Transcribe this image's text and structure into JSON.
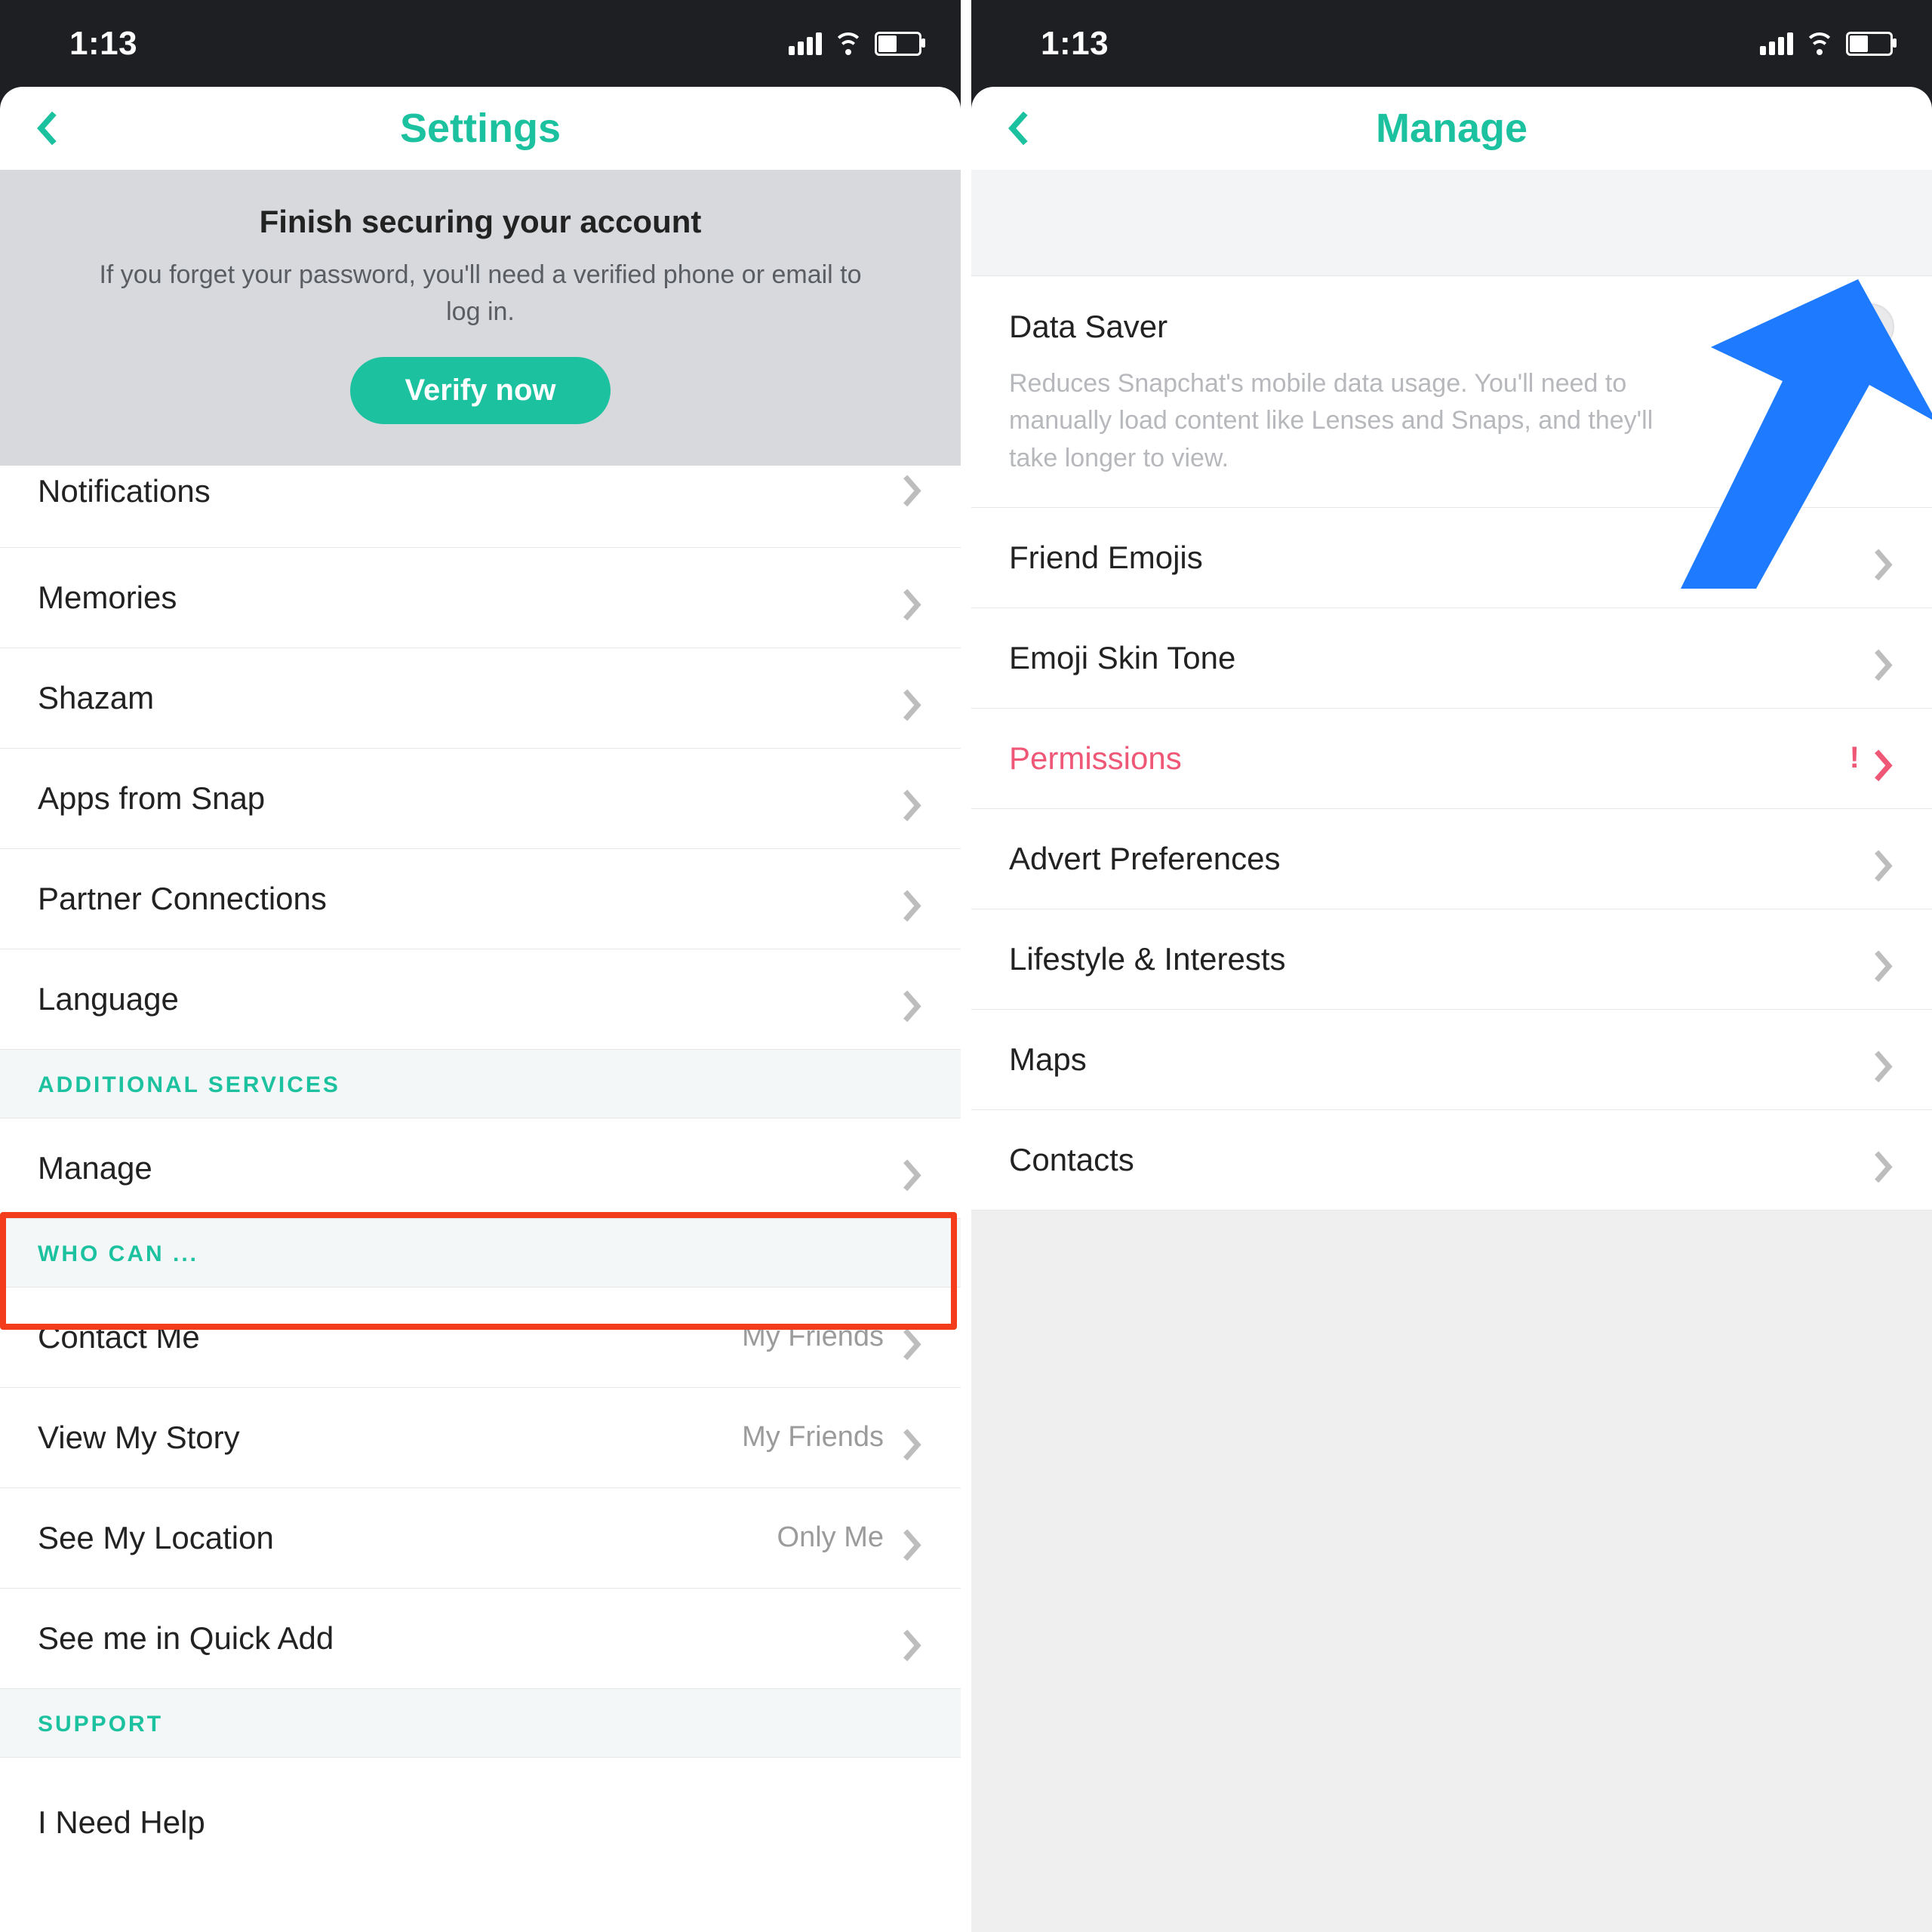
{
  "status": {
    "time": "1:13"
  },
  "left": {
    "title": "Settings",
    "banner": {
      "title": "Finish securing your account",
      "desc": "If you forget your password, you'll need a verified phone or email to log in.",
      "cta": "Verify now"
    },
    "rows_top": [
      {
        "label": "Notifications"
      },
      {
        "label": "Memories"
      },
      {
        "label": "Shazam"
      },
      {
        "label": "Apps from Snap"
      },
      {
        "label": "Partner Connections"
      },
      {
        "label": "Language"
      }
    ],
    "section_additional": "ADDITIONAL SERVICES",
    "rows_additional": [
      {
        "label": "Manage"
      }
    ],
    "section_who": "WHO CAN ...",
    "rows_who": [
      {
        "label": "Contact Me",
        "value": "My Friends"
      },
      {
        "label": "View My Story",
        "value": "My Friends"
      },
      {
        "label": "See My Location",
        "value": "Only Me"
      },
      {
        "label": "See me in Quick Add",
        "value": ""
      }
    ],
    "section_support": "SUPPORT",
    "rows_support": [
      {
        "label": "I Need Help"
      }
    ]
  },
  "right": {
    "title": "Manage",
    "data_saver": {
      "title": "Data Saver",
      "desc": "Reduces Snapchat's mobile data usage. You'll need to manually load content like Lenses and Snaps, and they'll take longer to view.",
      "on": false
    },
    "rows": [
      {
        "label": "Friend Emojis",
        "warn": false
      },
      {
        "label": "Emoji Skin Tone",
        "warn": false
      },
      {
        "label": "Permissions",
        "warn": true
      },
      {
        "label": "Advert Preferences",
        "warn": false
      },
      {
        "label": "Lifestyle & Interests",
        "warn": false
      },
      {
        "label": "Maps",
        "warn": false
      },
      {
        "label": "Contacts",
        "warn": false
      }
    ]
  }
}
